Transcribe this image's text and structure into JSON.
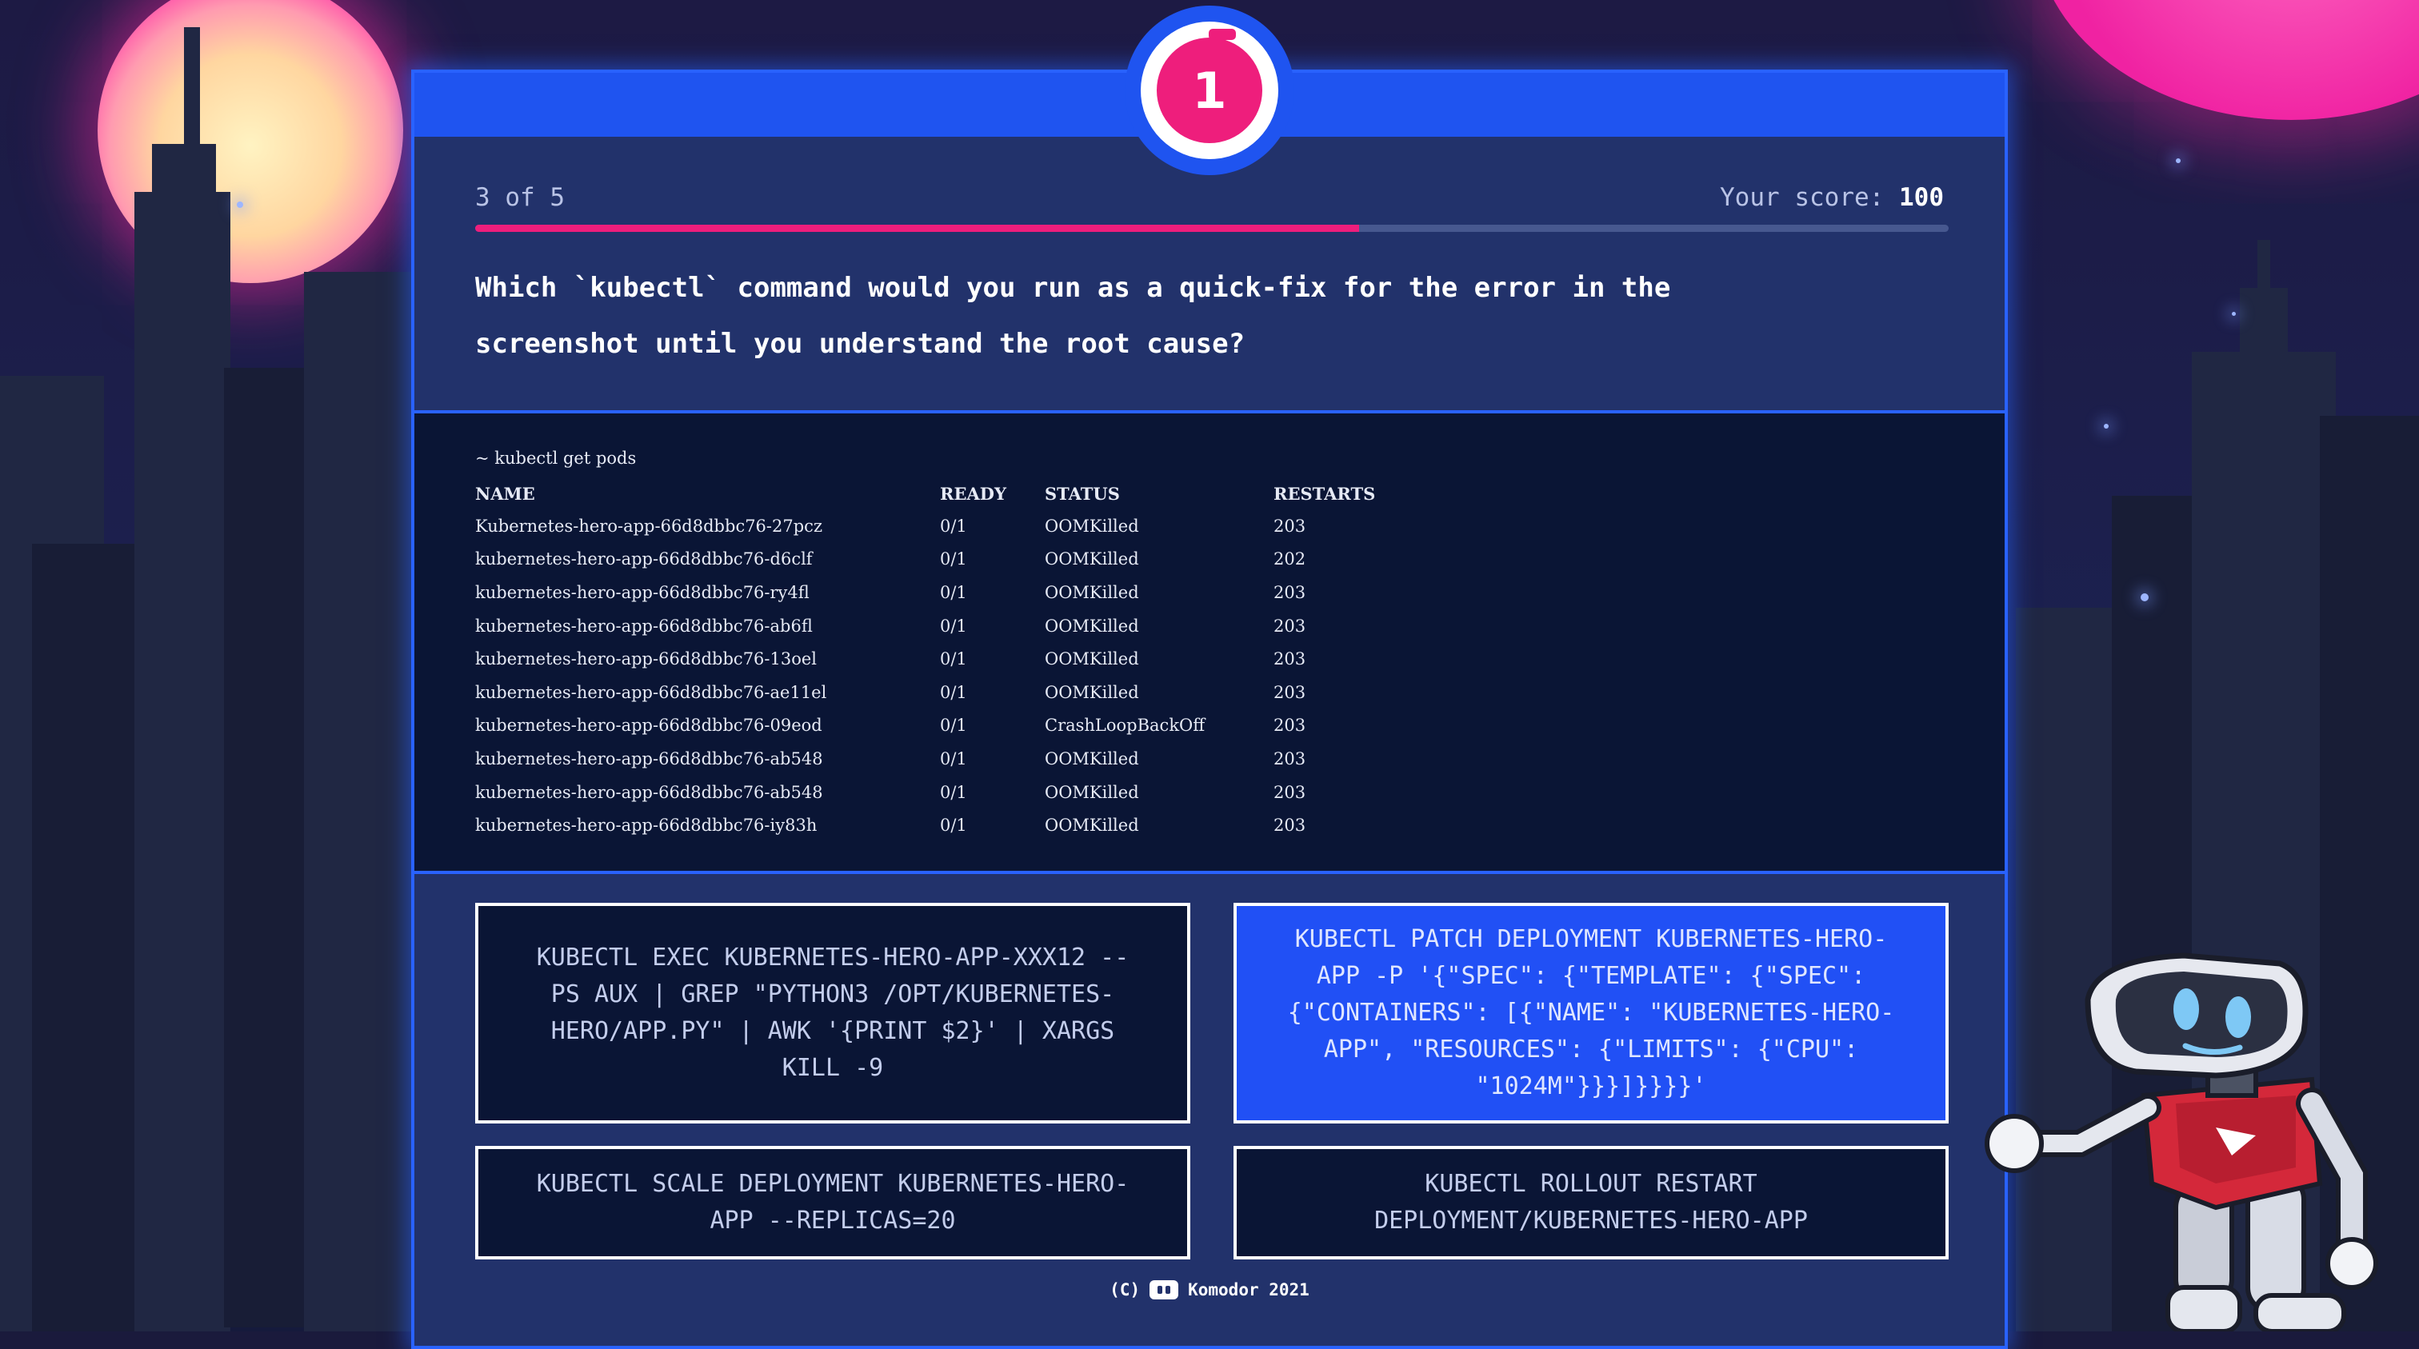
{
  "timer": {
    "value": "1"
  },
  "progress": {
    "label": "3 of 5",
    "current": 3,
    "total": 5,
    "fill_fraction": 0.6
  },
  "score": {
    "label": "Your score:",
    "value": "100"
  },
  "question": "Which `kubectl` command would you run as a quick-fix for the error in the screenshot until you understand the root cause?",
  "terminal": {
    "command": "~ kubectl get pods",
    "headers": [
      "NAME",
      "READY",
      "STATUS",
      "RESTARTS"
    ],
    "rows": [
      [
        "Kubernetes-hero-app-66d8dbbc76-27pcz",
        "0/1",
        "OOMKilled",
        "203"
      ],
      [
        "kubernetes-hero-app-66d8dbbc76-d6clf",
        "0/1",
        "OOMKilled",
        "202"
      ],
      [
        "kubernetes-hero-app-66d8dbbc76-ry4fl",
        "0/1",
        "OOMKilled",
        "203"
      ],
      [
        "kubernetes-hero-app-66d8dbbc76-ab6fl",
        "0/1",
        "OOMKilled",
        "203"
      ],
      [
        "kubernetes-hero-app-66d8dbbc76-13oel",
        "0/1",
        "OOMKilled",
        "203"
      ],
      [
        "kubernetes-hero-app-66d8dbbc76-ae11el",
        "0/1",
        "OOMKilled",
        "203"
      ],
      [
        "kubernetes-hero-app-66d8dbbc76-09eod",
        "0/1",
        "CrashLoopBackOff",
        "203"
      ],
      [
        "kubernetes-hero-app-66d8dbbc76-ab548",
        "0/1",
        "OOMKilled",
        "203"
      ],
      [
        "kubernetes-hero-app-66d8dbbc76-ab548",
        "0/1",
        "OOMKilled",
        "203"
      ],
      [
        "kubernetes-hero-app-66d8dbbc76-iy83h",
        "0/1",
        "OOMKilled",
        "203"
      ]
    ]
  },
  "answers": [
    {
      "text": "kubectl exec kubernetes-hero-app-xxx12 -- ps aux | grep \"python3 /opt/kubernetes-hero/app.py\" | awk '{print $2}' | xargs kill -9",
      "selected": false
    },
    {
      "text": "kubectl patch deployment kubernetes-hero-app -p '{\"spec\": {\"template\": {\"spec\": {\"containers\": [{\"name\": \"kubernetes-hero-app\", \"resources\": {\"limits\": {\"cpu\": \"1024m\"}}}]}}}}'",
      "selected": true
    },
    {
      "text": "kubectl scale deployment kubernetes-hero-app --replicas=20",
      "selected": false
    },
    {
      "text": "kubectl rollout restart deployment/kubernetes-hero-app",
      "selected": false
    }
  ],
  "footer": {
    "copyright": "(C)",
    "brand": "Komodor 2021"
  },
  "icons": {
    "timer": "stopwatch-icon",
    "brand_logo": "komodor-logo-icon",
    "mascot": "robot-mascot"
  },
  "colors": {
    "accent_blue": "#2962ff",
    "accent_pink": "#ee1e7c",
    "panel_bg": "#22326b",
    "terminal_bg": "#0a1535",
    "selected_answer": "#2150f5"
  }
}
